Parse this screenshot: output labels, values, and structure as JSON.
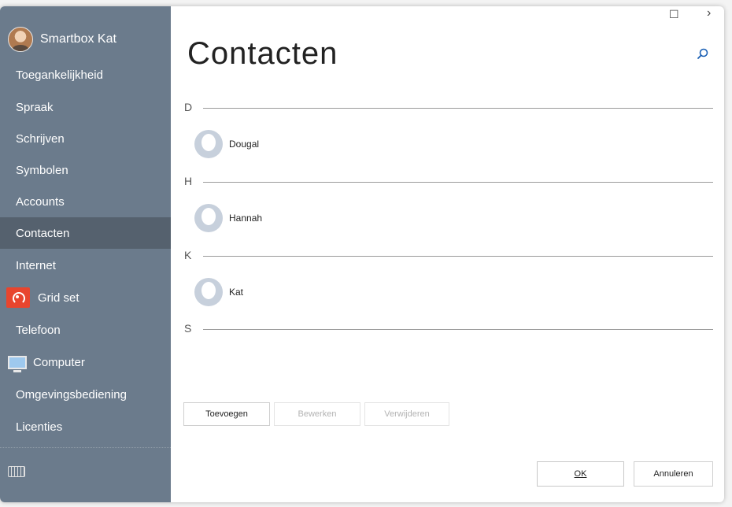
{
  "window": {
    "maximize_glyph": "☐",
    "next_glyph": "›"
  },
  "sidebar": {
    "user_name": "Smartbox Kat",
    "items": [
      {
        "label": "Toegankelijkheid"
      },
      {
        "label": "Spraak"
      },
      {
        "label": "Schrijven"
      },
      {
        "label": "Symbolen"
      },
      {
        "label": "Accounts"
      },
      {
        "label": "Contacten",
        "active": true
      },
      {
        "label": "Internet"
      },
      {
        "label": "Grid set",
        "icon": "grid-set-icon"
      },
      {
        "label": "Telefoon"
      },
      {
        "label": "Computer",
        "icon": "computer-icon"
      },
      {
        "label": "Omgevingsbediening"
      },
      {
        "label": "Licenties"
      }
    ],
    "keyboard_icon": "keyboard-icon"
  },
  "main": {
    "title": "Contacten",
    "search_icon": "search-icon",
    "groups": [
      {
        "letter": "D",
        "contacts": [
          "Dougal"
        ]
      },
      {
        "letter": "H",
        "contacts": [
          "Hannah"
        ]
      },
      {
        "letter": "K",
        "contacts": [
          "Kat"
        ]
      },
      {
        "letter": "S",
        "contacts": []
      }
    ]
  },
  "actions": {
    "add": "Toevoegen",
    "edit": "Bewerken",
    "delete": "Verwijderen"
  },
  "footer": {
    "ok": "OK",
    "cancel": "Annuleren"
  },
  "colors": {
    "sidebar_bg": "#6b7b8c",
    "sidebar_active": "#55616e",
    "grid_set_accent": "#e8452e",
    "search_accent": "#1a5fb4"
  }
}
